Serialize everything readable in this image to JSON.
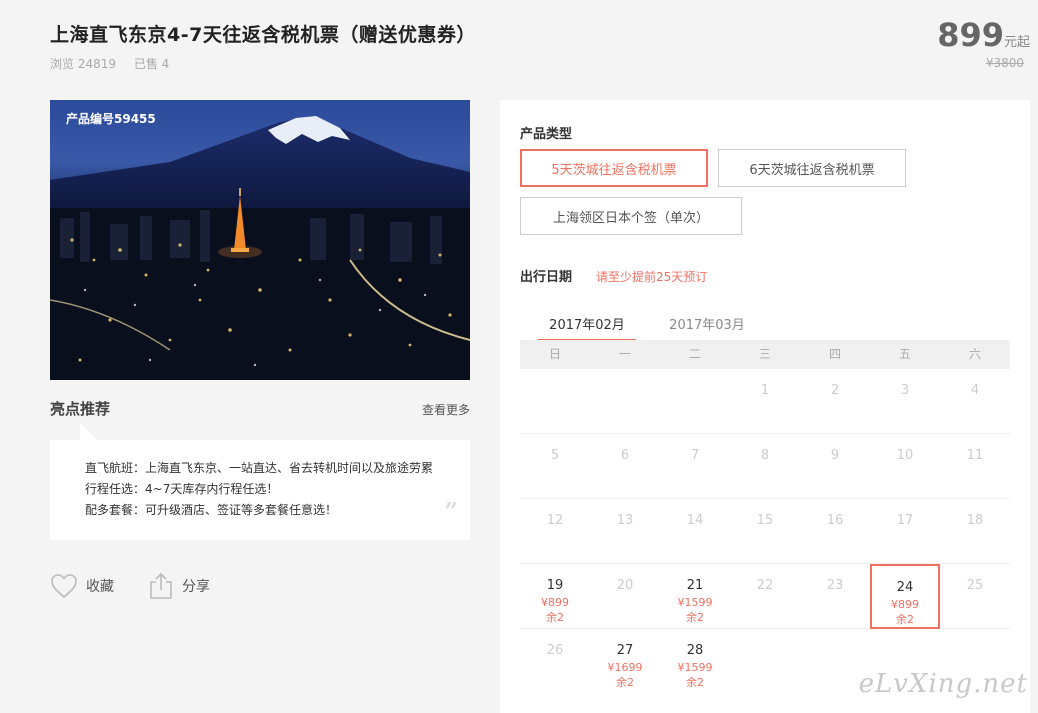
{
  "header": {
    "title": "上海直飞东京4-7天往返含税机票（赠送优惠券）",
    "views": "浏览 24819",
    "sold": "已售 4"
  },
  "price": {
    "value": "899",
    "unit": "元起",
    "original": "¥3800"
  },
  "hero": {
    "product_code": "产品编号59455"
  },
  "highlights": {
    "title": "亮点推荐",
    "more_label": "查看更多",
    "lines": [
      "直飞航班：上海直飞东京、一站直达、省去转机时间以及旅途劳累",
      "行程任选：4~7天库存内行程任选！",
      "配多套餐：可升级酒店、签证等多套餐任意选！"
    ]
  },
  "actions": {
    "favorite": "收藏",
    "share": "分享"
  },
  "product_type": {
    "label": "产品类型",
    "options": [
      "5天茨城往返含税机票",
      "6天茨城往返含税机票",
      "上海领区日本个签（单次）"
    ],
    "selected_index": 0
  },
  "travel_date": {
    "label": "出行日期",
    "note": "请至少提前25天预订",
    "tabs": [
      "2017年02月",
      "2017年03月"
    ],
    "active_tab": 0,
    "weekdays": [
      "日",
      "一",
      "二",
      "三",
      "四",
      "五",
      "六"
    ],
    "weeks": [
      [
        null,
        null,
        null,
        {
          "day": "1"
        },
        {
          "day": "2"
        },
        {
          "day": "3"
        },
        {
          "day": "4"
        }
      ],
      [
        {
          "day": "5"
        },
        {
          "day": "6"
        },
        {
          "day": "7"
        },
        {
          "day": "8"
        },
        {
          "day": "9"
        },
        {
          "day": "10"
        },
        {
          "day": "11"
        }
      ],
      [
        {
          "day": "12"
        },
        {
          "day": "13"
        },
        {
          "day": "14"
        },
        {
          "day": "15"
        },
        {
          "day": "16"
        },
        {
          "day": "17"
        },
        {
          "day": "18"
        }
      ],
      [
        {
          "day": "19",
          "price": "¥899",
          "remain": "余2"
        },
        {
          "day": "20"
        },
        {
          "day": "21",
          "price": "¥1599",
          "remain": "余2"
        },
        {
          "day": "22"
        },
        {
          "day": "23"
        },
        {
          "day": "24",
          "price": "¥899",
          "remain": "余2",
          "selected": true
        },
        {
          "day": "25"
        }
      ],
      [
        {
          "day": "26"
        },
        {
          "day": "27",
          "price": "¥1699",
          "remain": "余2"
        },
        {
          "day": "28",
          "price": "¥1599",
          "remain": "余2"
        },
        null,
        null,
        null,
        null
      ]
    ]
  },
  "watermark": "eLvXing.net",
  "colors": {
    "accent": "#f07060",
    "price_gray": "#666666",
    "background": "#f4f4f4"
  }
}
